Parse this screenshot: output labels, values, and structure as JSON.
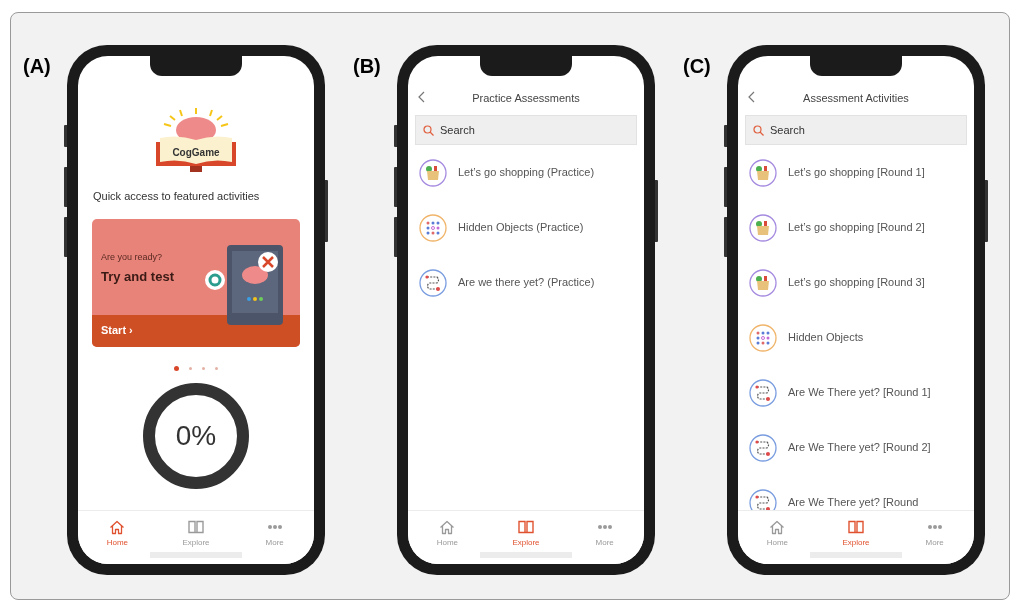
{
  "panels": [
    {
      "label": "(A)",
      "kind": "home",
      "logo_text": "CogGame",
      "intro": "Quick access to featured activities",
      "card": {
        "eyebrow": "Are you ready?",
        "title": "Try and test",
        "action": "Start ›"
      },
      "carousel_dots": [
        {
          "selected": true
        },
        {
          "selected": false
        },
        {
          "selected": false
        },
        {
          "selected": false
        }
      ],
      "progress": "0%",
      "tabs": [
        {
          "kind": "home",
          "label": "Home",
          "selected": true
        },
        {
          "kind": "explore",
          "label": "Explore",
          "selected": false
        },
        {
          "kind": "more",
          "label": "More",
          "selected": false
        }
      ]
    },
    {
      "label": "(B)",
      "kind": "list",
      "title": "Practice Assessments",
      "search": {
        "placeholder": "Search"
      },
      "items": [
        {
          "kind": "shopping",
          "label": "Let’s go shopping (Practice)"
        },
        {
          "kind": "hidden",
          "label": "Hidden Objects (Practice)"
        },
        {
          "kind": "route",
          "label": "Are we there yet? (Practice)"
        }
      ],
      "tabs": [
        {
          "kind": "home",
          "label": "Home",
          "selected": false
        },
        {
          "kind": "explore",
          "label": "Explore",
          "selected": true
        },
        {
          "kind": "more",
          "label": "More",
          "selected": false
        }
      ]
    },
    {
      "label": "(C)",
      "kind": "list",
      "title": "Assessment Activities",
      "search": {
        "placeholder": "Search"
      },
      "items": [
        {
          "kind": "shopping",
          "label": "Let’s go shopping [Round 1]"
        },
        {
          "kind": "shopping",
          "label": "Let’s go shopping [Round 2]"
        },
        {
          "kind": "shopping",
          "label": "Let’s go shopping [Round 3]"
        },
        {
          "kind": "hidden",
          "label": "Hidden Objects"
        },
        {
          "kind": "route",
          "label": "Are We There yet? [Round 1]"
        },
        {
          "kind": "route",
          "label": "Are We There yet? [Round 2]"
        },
        {
          "kind": "route",
          "label": "Are We There yet? [Round"
        }
      ],
      "tabs": [
        {
          "kind": "home",
          "label": "Home",
          "selected": false
        },
        {
          "kind": "explore",
          "label": "Explore",
          "selected": true
        },
        {
          "kind": "more",
          "label": "More",
          "selected": false
        }
      ]
    }
  ]
}
